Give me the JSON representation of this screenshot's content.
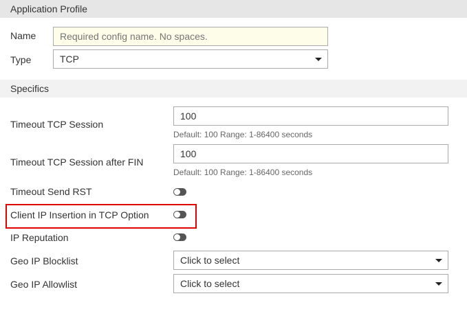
{
  "header": {
    "title": "Application Profile"
  },
  "name": {
    "label": "Name",
    "placeholder": "Required config name. No spaces.",
    "value": ""
  },
  "type": {
    "label": "Type",
    "value": "TCP"
  },
  "specifics": {
    "title": "Specifics"
  },
  "timeout_tcp": {
    "label": "Timeout TCP Session",
    "value": "100",
    "help": "Default: 100 Range: 1-86400 seconds"
  },
  "timeout_fin": {
    "label": "Timeout TCP Session after FIN",
    "value": "100",
    "help": "Default: 100 Range: 1-86400 seconds"
  },
  "send_rst": {
    "label": "Timeout Send RST",
    "enabled": false
  },
  "client_ip": {
    "label": "Client IP Insertion in TCP Option",
    "enabled": false
  },
  "ip_rep": {
    "label": "IP Reputation",
    "enabled": false
  },
  "geo_block": {
    "label": "Geo IP Blocklist",
    "value": "Click to select"
  },
  "geo_allow": {
    "label": "Geo IP Allowlist",
    "value": "Click to select"
  },
  "colors": {
    "highlight": "#e00000",
    "name_bg": "#fdfde9"
  }
}
